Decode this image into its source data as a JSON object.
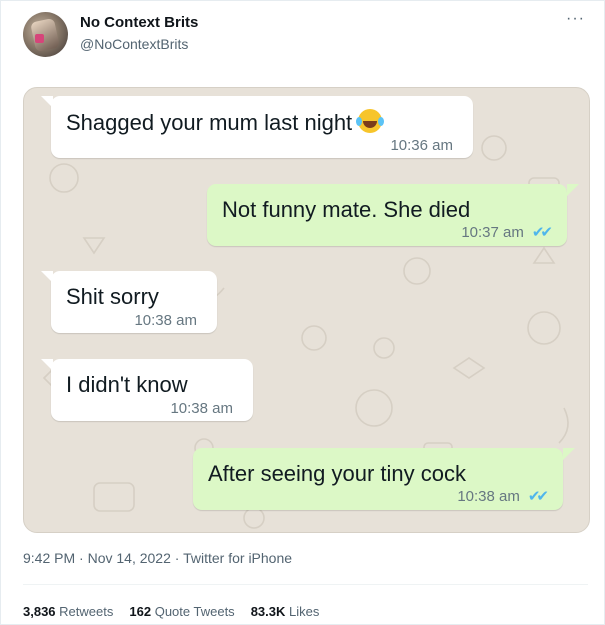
{
  "tweet": {
    "display_name": "No Context Brits",
    "handle": "@NoContextBrits",
    "more_icon": "more-horizontal-icon",
    "meta": {
      "time": "9:42 PM",
      "date": "Nov 14, 2022",
      "source": "Twitter for iPhone",
      "separator": "·"
    },
    "stats": {
      "retweets_count": "3,836",
      "retweets_label": "Retweets",
      "quotes_count": "162",
      "quotes_label": "Quote Tweets",
      "likes_count": "83.3K",
      "likes_label": "Likes"
    }
  },
  "chat": {
    "messages": [
      {
        "direction": "in",
        "text": "Shagged your mum last night",
        "emoji": "face-with-tears-of-joy",
        "time": "10:36 am"
      },
      {
        "direction": "out",
        "text": "Not funny mate. She died",
        "time": "10:37 am",
        "read": true
      },
      {
        "direction": "in",
        "text": "Shit sorry",
        "time": "10:38 am"
      },
      {
        "direction": "in",
        "text": "I didn't know",
        "time": "10:38 am"
      },
      {
        "direction": "out",
        "text": "After seeing your tiny cock",
        "time": "10:38 am",
        "read": true
      }
    ]
  },
  "colors": {
    "incoming_bubble": "#ffffff",
    "outgoing_bubble": "#dcf8c6",
    "chat_background": "#e7e1d8",
    "read_ticks": "#4fb6ec",
    "muted_text": "#536471"
  }
}
